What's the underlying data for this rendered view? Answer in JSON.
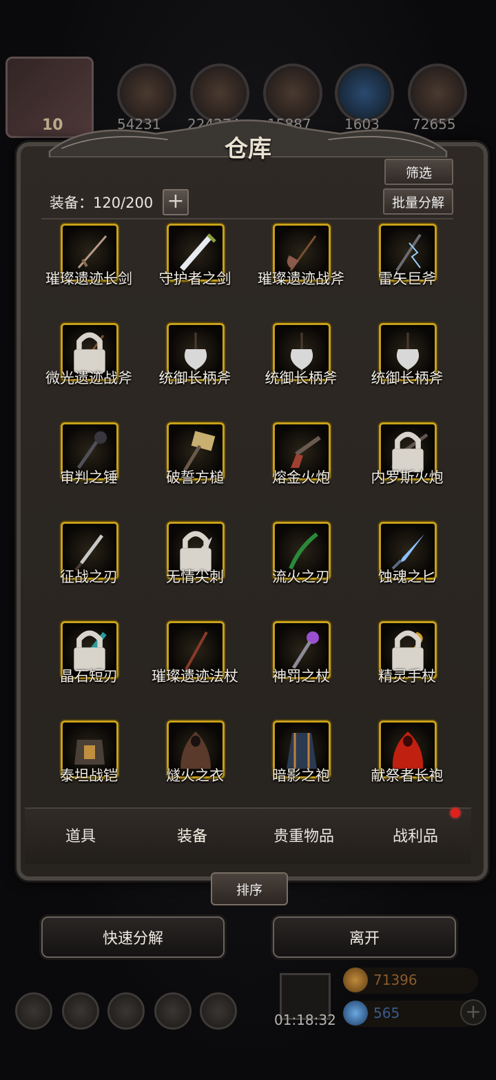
{
  "header": {
    "title": "仓库",
    "level_badge": "10",
    "resources": [
      "54231",
      "224274",
      "15887",
      "1603",
      "72655"
    ]
  },
  "toolbar": {
    "filter_label": "筛选",
    "batch_label": "批量分解",
    "equip_count": "装备：120/200"
  },
  "items": [
    {
      "name": "璀璨遗迹长剑",
      "icon": "sword-icon",
      "locked": false
    },
    {
      "name": "守护者之剑",
      "icon": "greatsword-icon",
      "locked": false
    },
    {
      "name": "璀璨遗迹战斧",
      "icon": "axe-icon",
      "locked": false
    },
    {
      "name": "雷矢巨斧",
      "icon": "lightning-axe-icon",
      "locked": false
    },
    {
      "name": "微光遗迹战斧",
      "icon": "axe-icon",
      "locked": true
    },
    {
      "name": "统御长柄斧",
      "icon": "poleaxe-icon",
      "locked": false
    },
    {
      "name": "统御长柄斧",
      "icon": "poleaxe-icon",
      "locked": false
    },
    {
      "name": "统御长柄斧",
      "icon": "poleaxe-icon",
      "locked": false
    },
    {
      "name": "审判之锤",
      "icon": "mace-icon",
      "locked": false
    },
    {
      "name": "破誓方槌",
      "icon": "hammer-icon",
      "locked": false
    },
    {
      "name": "熔金火炮",
      "icon": "pistol-icon",
      "locked": false
    },
    {
      "name": "内罗斯火炮",
      "icon": "rifle-icon",
      "locked": true
    },
    {
      "name": "征战之刃",
      "icon": "dagger-icon",
      "locked": false
    },
    {
      "name": "无情尖刺",
      "icon": "curved-blade-icon",
      "locked": true
    },
    {
      "name": "流火之刃",
      "icon": "green-blade-icon",
      "locked": false
    },
    {
      "name": "蚀魂之匕",
      "icon": "crystal-dagger-icon",
      "locked": false
    },
    {
      "name": "晶石短刃",
      "icon": "crystal-shortblade-icon",
      "locked": true
    },
    {
      "name": "璀璨遗迹法杖",
      "icon": "staff-icon",
      "locked": false
    },
    {
      "name": "神罚之杖",
      "icon": "orb-staff-icon",
      "locked": false
    },
    {
      "name": "精灵手杖",
      "icon": "elf-staff-icon",
      "locked": true
    },
    {
      "name": "泰坦战铠",
      "icon": "armor-icon",
      "locked": false
    },
    {
      "name": "燧火之衣",
      "icon": "cloak-icon",
      "locked": false
    },
    {
      "name": "暗影之袍",
      "icon": "robe-icon",
      "locked": false
    },
    {
      "name": "献祭者长袍",
      "icon": "red-robe-icon",
      "locked": false
    }
  ],
  "tabs": [
    {
      "label": "道具",
      "active": false
    },
    {
      "label": "装备",
      "active": true
    },
    {
      "label": "贵重物品",
      "active": false
    },
    {
      "label": "战利品",
      "active": false
    }
  ],
  "actions": {
    "sort_label": "排序",
    "quick_decompose_label": "快速分解",
    "leave_label": "离开"
  },
  "footer": {
    "timer": "01:18:32",
    "gold": "71396",
    "gems": "565"
  },
  "colors": {
    "slot_border": "#c9a11a",
    "gold_text": "#8a5a2c",
    "gem_text": "#3a5a8a",
    "notification": "#e0201c"
  }
}
